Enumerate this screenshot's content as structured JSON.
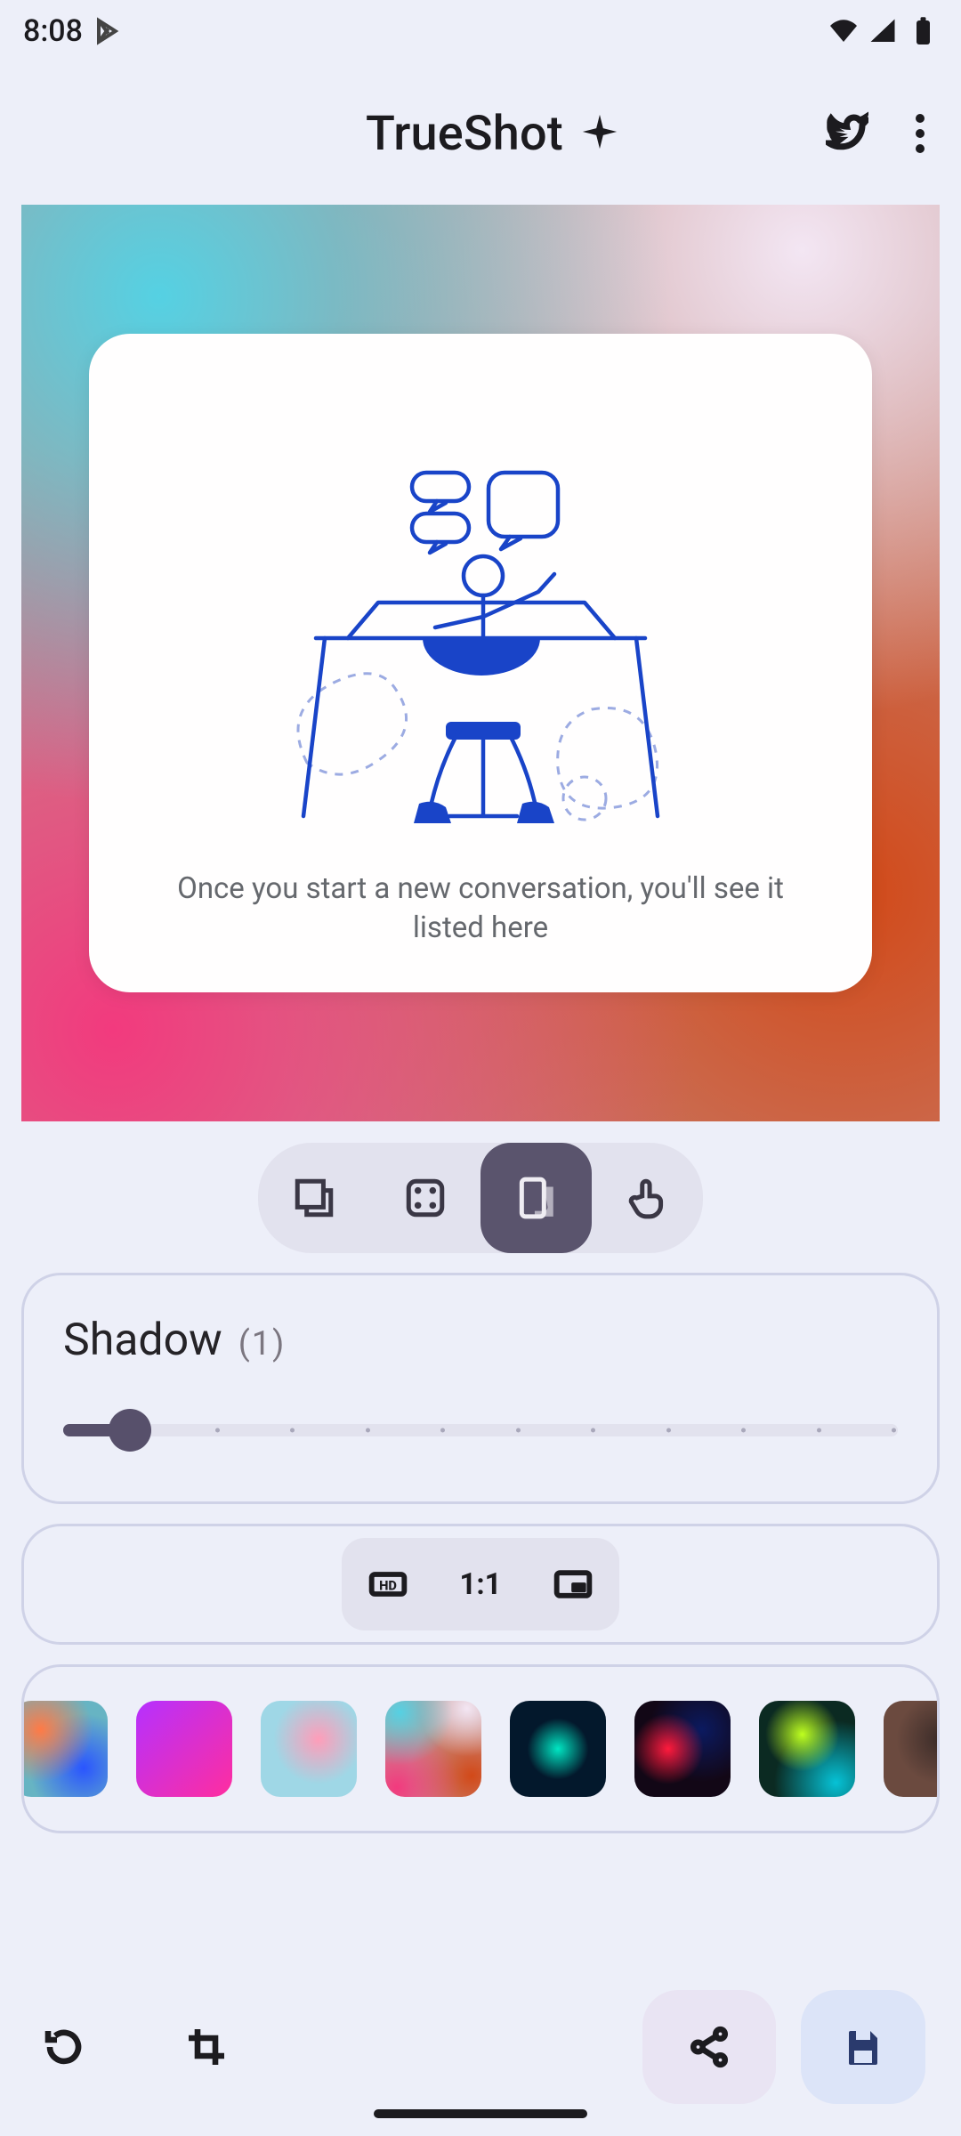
{
  "status": {
    "time": "8:08"
  },
  "header": {
    "title": "TrueShot"
  },
  "preview": {
    "caption": "Once you start a new conversation, you'll see it listed here"
  },
  "shadow": {
    "label": "Shadow",
    "value_display": "(1)",
    "value": 1,
    "min": 0,
    "max": 12,
    "fill_percent": 8
  },
  "aspect": {
    "options": [
      "HD",
      "1:1",
      "miniplayer"
    ],
    "selected": "1:1"
  },
  "backgrounds": [
    {
      "css": "radial-gradient(circle at 30% 30%, #ff7a46 0%, rgba(255,122,70,0) 55%), radial-gradient(circle at 75% 70%, #2a55ff 0%, rgba(42,85,255,0) 55%), linear-gradient(#67b4c3,#67b4c3)"
    },
    {
      "css": "linear-gradient(135deg,#b530ff 0%,#ff2e9f 100%)"
    },
    {
      "css": "radial-gradient(circle at 60% 40%, #ff9db9 0%, rgba(255,157,185,0) 55%), linear-gradient(#9fd7e6,#9fd7e6)"
    },
    {
      "css": "radial-gradient(circle at 15% 12%, #55d1e3 0%, rgba(85,209,227,0) 45%), radial-gradient(circle at 85% 8%, #f3e6f3 0%, rgba(243,230,243,0) 40%), radial-gradient(circle at 12% 90%, #f23a7e 0%, rgba(242,58,126,0) 52%), radial-gradient(circle at 90% 78%, #d24918 0%, rgba(210,73,24,0) 55%), linear-gradient(#c49490,#c49490)"
    },
    {
      "css": "radial-gradient(circle at 50% 50%, #00e6c3 0%, rgba(0,230,195,0) 45%), linear-gradient(#03182c,#03182c)"
    },
    {
      "css": "radial-gradient(circle at 35% 50%, #ff1a3c 0%, rgba(255,26,60,0) 45%), radial-gradient(circle at 70% 30%, #0b1a60 0%, rgba(11,26,96,0) 55%), linear-gradient(#120716,#120716)"
    },
    {
      "css": "radial-gradient(circle at 45% 35%, #beff1f 0%, rgba(190,255,31,0) 45%), radial-gradient(circle at 80% 85%, #06c2d6 0%, rgba(6,194,214,0) 55%), linear-gradient(#0b2a22,#0b2a22)"
    },
    {
      "css": "radial-gradient(circle at 60% 40%, #3a2b28 0%, rgba(58,43,40,0) 55%), linear-gradient(#6b4a3f,#6b4a3f)"
    }
  ]
}
